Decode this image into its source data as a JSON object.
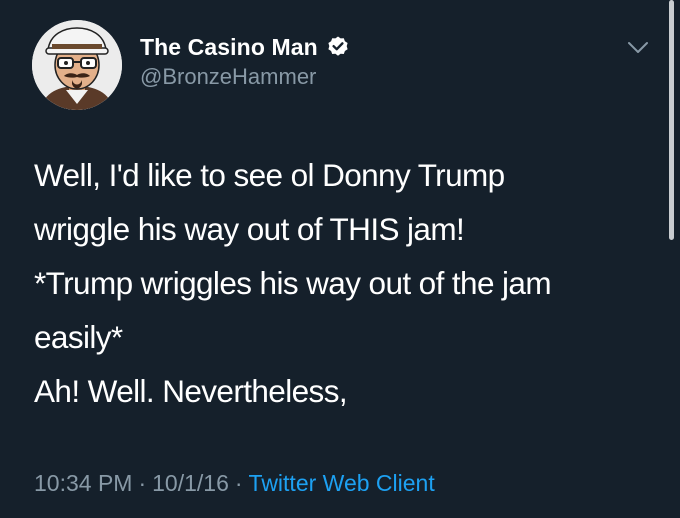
{
  "author": {
    "display_name": "The Casino Man",
    "handle": "@BronzeHammer",
    "verified": true,
    "avatar_icon": "cartoon-man-avatar-icon",
    "verified_icon": "verified-badge-icon"
  },
  "tweet": {
    "lines": [
      "Well, I'd like to see ol Donny Trump",
      "wriggle his way out of THIS jam!",
      "*Trump wriggles his way out of the jam",
      "easily*",
      "Ah! Well. Nevertheless,"
    ]
  },
  "meta": {
    "time": "10:34 PM",
    "separator": "·",
    "date": "10/1/16",
    "client": "Twitter Web Client"
  },
  "colors": {
    "background": "#15202b",
    "primary_text": "#ffffff",
    "secondary_text": "#8899a6",
    "link": "#1da1f2"
  },
  "menu_icon": "chevron-down-icon"
}
